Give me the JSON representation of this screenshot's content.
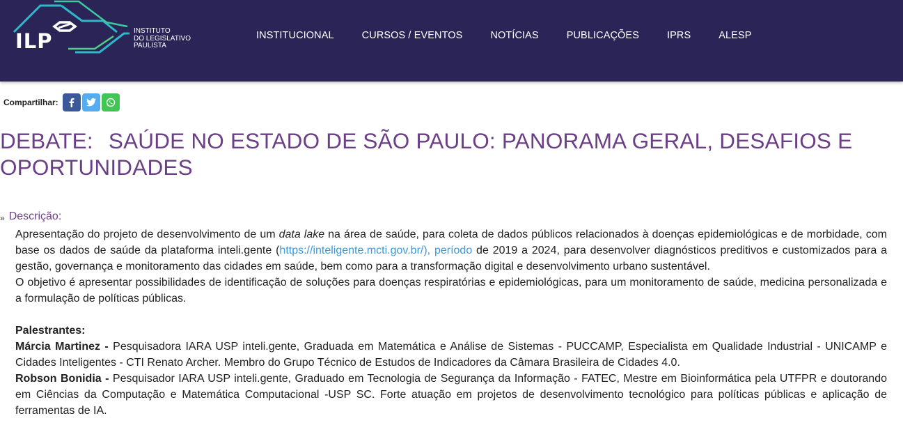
{
  "brand": {
    "logo_abbr": "ILP",
    "logo_line1": "INSTITUTO",
    "logo_line2": "DO LEGISLATIVO",
    "logo_line3": "PAULISTA"
  },
  "nav": [
    "INSTITUCIONAL",
    "CURSOS / EVENTOS",
    "NOTÍCIAS",
    "PUBLICAÇÕES",
    "IPRS",
    "ALESP"
  ],
  "share": {
    "label": "Compartilhar:"
  },
  "title": {
    "prefix": "DEBATE:",
    "text": "SAÚDE NO ESTADO DE SÃO PAULO: PANORAMA GERAL, DESAFIOS E OPORTUNIDADES"
  },
  "description": {
    "heading": "Descrição:",
    "p1_a": "Apresentação do projeto de desenvolvimento de um ",
    "p1_em": "data lake",
    "p1_b": " na área de saúde, para  coleta de dados públicos relacionados à doenças epidemiológicas e de morbidade, com base os dados de saúde da plataforma inteli.gente (",
    "p1_link": "https://inteligente.mcti.gov.br/), período",
    "p1_c": " de 2019 a 2024, para desenvolver diagnósticos preditivos e customizados para a gestão, governança e monitoramento das cidades em saúde, bem como para a transformação digital e desenvolvimento urbano sustentável.",
    "p2": "O objetivo é apresentar possibilidades de identificação de soluções para doenças respiratórias e epidemiológicas, para um monitoramento de saúde, medicina personalizada e a formulação de políticas públicas.",
    "speakers_heading": "Palestrantes:",
    "speaker1_name": "Márcia Martinez -",
    "speaker1_bio": " Pesquisadora IARA USP inteli.gente, Graduada em Matemática e Análise de Sistemas  - PUCCAMP, Especialista em Qualidade Industrial - UNICAMP e Cidades Inteligentes - CTI Renato Archer. Membro do Grupo Técnico de Estudos de Indicadores da Câmara Brasileira de Cidades 4.0.",
    "speaker2_name": "Robson Bonidia -",
    "speaker2_bio": " Pesquisador IARA USP inteli.gente, Graduado em Tecnologia de Segurança da Informação - FATEC, Mestre em Bioinformática pela UTFPR e doutorando em Ciências da Computação e Matemática Computacional -USP SC. Forte atuação em projetos de desenvolvimento tecnológico para políticas públicas e aplicação de ferramentas de IA."
  }
}
